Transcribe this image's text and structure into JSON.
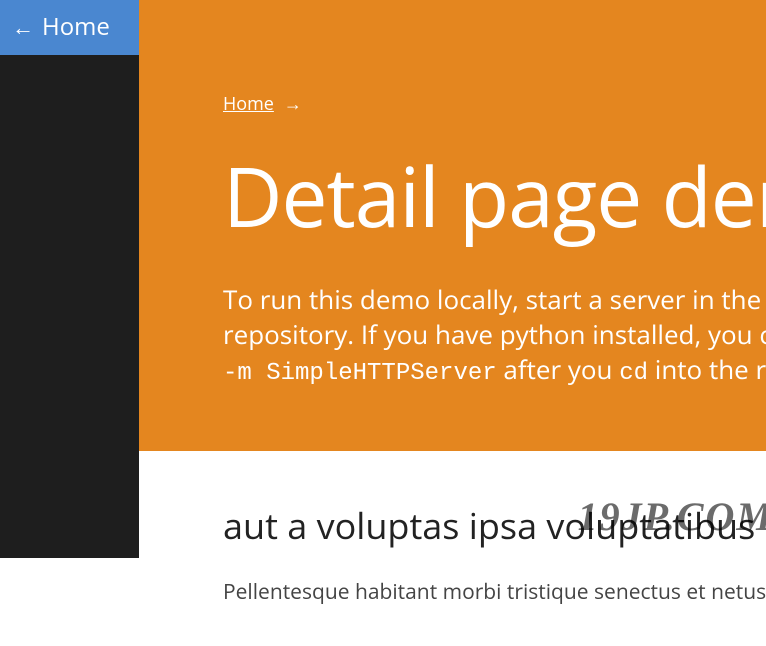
{
  "sidebar": {
    "home_label": "Home",
    "home_arrow": "←"
  },
  "breadcrumb": {
    "home_label": "Home",
    "arrow": "→"
  },
  "hero": {
    "title": "Detail page demo",
    "intro_part1": "To run this demo locally, start a server in the root of",
    "intro_part2": "repository. If you have python installed, you can simply",
    "code1": "-m SimpleHTTPServer",
    "intro_part3": " after you ",
    "code2": "cd",
    "intro_part4": " into the repo."
  },
  "content": {
    "heading": "aut a voluptas ipsa voluptatibus repellendus",
    "paragraph": "Pellentesque habitant morbi tristique senectus et netus et"
  },
  "watermark": "19JP.COM"
}
